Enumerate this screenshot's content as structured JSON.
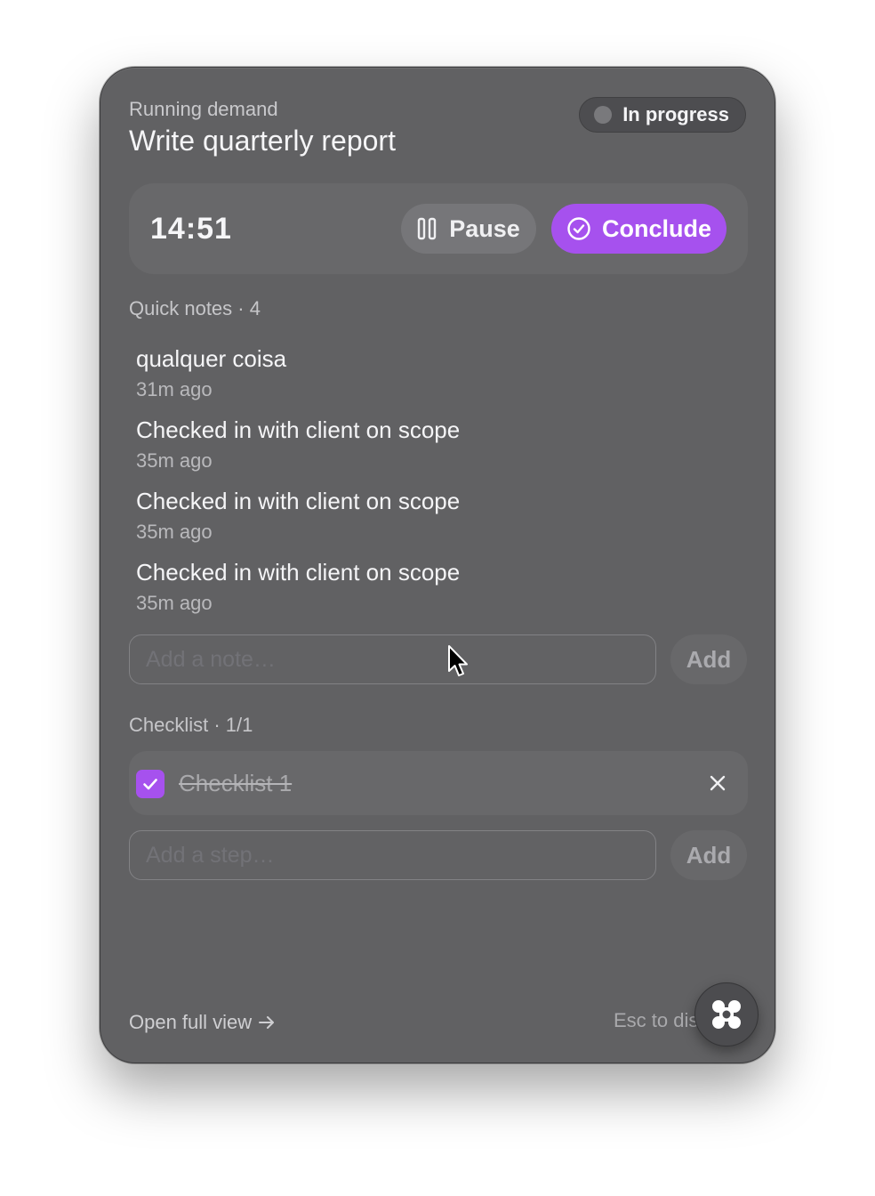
{
  "header": {
    "kicker": "Running demand",
    "title": "Write quarterly report",
    "status": "In progress"
  },
  "timer": {
    "value": "14:51",
    "pause_label": "Pause",
    "conclude_label": "Conclude"
  },
  "notes": {
    "section_label": "Quick notes · 4",
    "items": [
      {
        "text": "qualquer coisa",
        "time": "31m ago"
      },
      {
        "text": "Checked in with client on scope",
        "time": "35m ago"
      },
      {
        "text": "Checked in with client on scope",
        "time": "35m ago"
      },
      {
        "text": "Checked in with client on scope",
        "time": "35m ago"
      }
    ],
    "input_placeholder": "Add a note…",
    "add_label": "Add"
  },
  "checklist": {
    "section_label": "Checklist · 1/1",
    "items": [
      {
        "label": "Checklist 1",
        "checked": true
      }
    ],
    "input_placeholder": "Add a step…",
    "add_label": "Add"
  },
  "footer": {
    "open_full_label": "Open full view",
    "esc_hint": "Esc to dismiss"
  },
  "colors": {
    "accent": "#a651ee",
    "panel": "#616163"
  }
}
